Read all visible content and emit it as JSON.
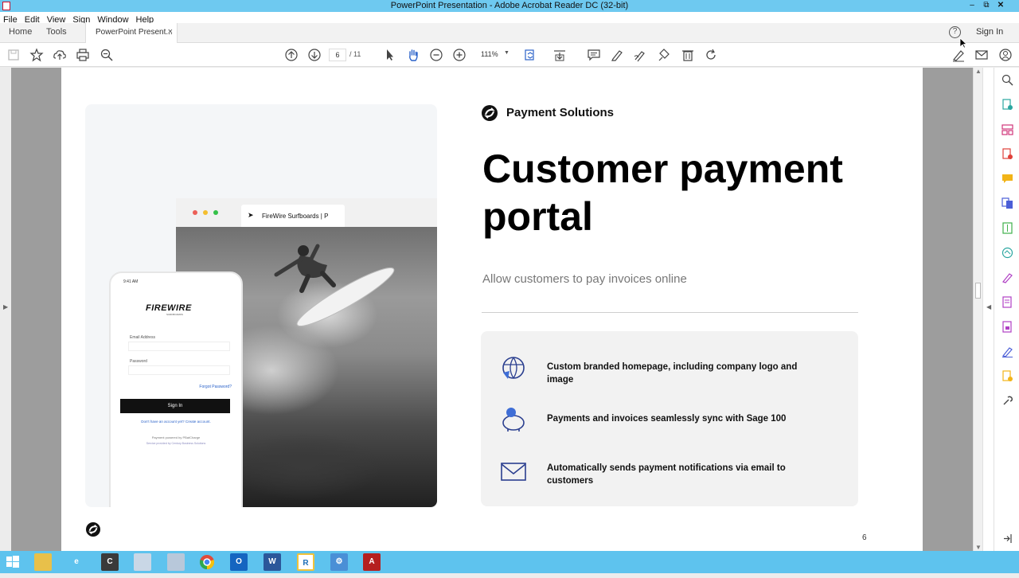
{
  "window": {
    "title": "PowerPoint Presentation - Adobe Acrobat Reader DC (32-bit)"
  },
  "menu": [
    "File",
    "Edit",
    "View",
    "Sign",
    "Window",
    "Help"
  ],
  "tabs": {
    "home": "Home",
    "tools": "Tools",
    "document": "PowerPoint Present...",
    "close": "×",
    "help": "?",
    "sign_in": "Sign In"
  },
  "toolbar": {
    "page_current": "6",
    "page_total": "/ 11",
    "zoom": "111%"
  },
  "slide": {
    "brand": "Payment Solutions",
    "heading": "Customer payment portal",
    "subheading": "Allow customers to pay invoices online",
    "features": [
      {
        "icon": "globe-icon",
        "text": "Custom branded homepage, including company logo and image"
      },
      {
        "icon": "piggy-bank-icon",
        "text": "Payments and invoices seamlessly sync with Sage 100"
      },
      {
        "icon": "envelope-icon",
        "text": "Automatically sends payment notifications via email to customers"
      }
    ],
    "page_number": "6",
    "browser_tab": "FireWire Surfboards | P",
    "phone": {
      "status": "9:41 AM",
      "logo": "FIREWIRE",
      "logo_sub": "SURFBOARDS",
      "email_label": "Email Address",
      "password_label": "Password",
      "forgot": "Forgot Password?",
      "signin": "Sign In",
      "no_account": "Don't have an account yet? Create account.",
      "powered": "Payment powered by  PBatCharge",
      "services": "Service provided by Century Business Solutions"
    }
  },
  "colors": {
    "titlebar": "#6ec9f0",
    "taskbar": "#5ec3ee",
    "accent_blue": "#2a62c9",
    "acrobat_red": "#c8102e"
  }
}
